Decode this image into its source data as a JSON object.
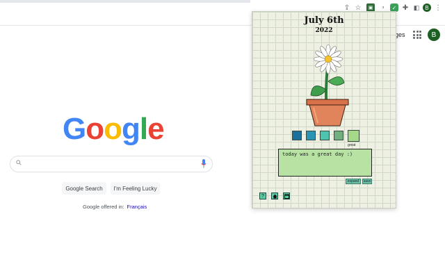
{
  "google": {
    "logo_letters": [
      "G",
      "o",
      "o",
      "g",
      "l",
      "e"
    ],
    "images_link": "ges",
    "avatar_initial": "B",
    "search_button": "Google Search",
    "lucky_button": "I'm Feeling Lucky",
    "offered_text": "Google offered in:",
    "offered_language": "Français"
  },
  "toolbar": {
    "profile_initial": "B"
  },
  "popup": {
    "date": "July 6th",
    "year": "2022",
    "mood_selected_label": "great",
    "journal_text": "today was a great day :)",
    "expand_label": "expand",
    "save_label": "save",
    "help_glyph": "?"
  },
  "colors": {
    "mood_swatches": [
      "#1b6f9c",
      "#2b93b6",
      "#4cc4b0",
      "#6fb07e",
      "#a6d88a"
    ]
  }
}
